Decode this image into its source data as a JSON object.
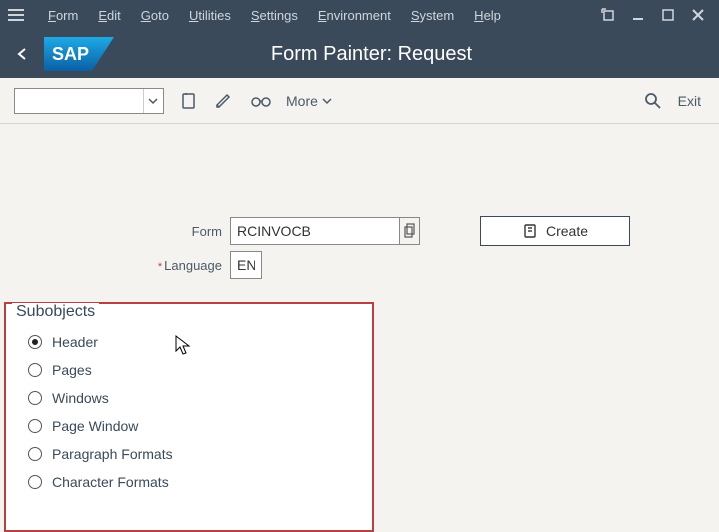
{
  "menubar": {
    "items": [
      {
        "pre": "F",
        "rest": "orm"
      },
      {
        "pre": "E",
        "rest": "dit"
      },
      {
        "pre": "G",
        "rest": "oto"
      },
      {
        "pre": "U",
        "rest": "tilities"
      },
      {
        "pre": "S",
        "rest": "ettings"
      },
      {
        "pre": "E",
        "rest": "nvironment"
      },
      {
        "pre": "S",
        "rest": "ystem"
      },
      {
        "pre": "H",
        "rest": "elp"
      }
    ]
  },
  "title": "Form Painter: Request",
  "toolbar": {
    "glasses_text": "",
    "more": "More",
    "exit": "Exit"
  },
  "form": {
    "form_label": "Form",
    "form_value": "RCINVOCB",
    "lang_label": "Language",
    "lang_value": "EN",
    "create_label": "Create"
  },
  "subobjects": {
    "legend": "Subobjects",
    "items": [
      {
        "label": "Header",
        "checked": true
      },
      {
        "label": "Pages",
        "checked": false
      },
      {
        "label": "Windows",
        "checked": false
      },
      {
        "label": "Page Window",
        "checked": false
      },
      {
        "label": "Paragraph Formats",
        "checked": false
      },
      {
        "label": "Character Formats",
        "checked": false
      }
    ]
  },
  "toolbar_glasses_badge": "&"
}
